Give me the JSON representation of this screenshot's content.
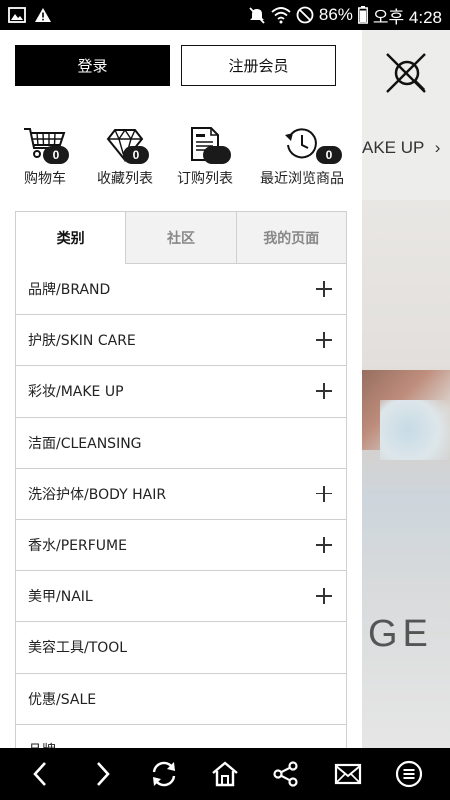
{
  "status_bar": {
    "battery": "86%",
    "time": "오후 4:28"
  },
  "background_page": {
    "banner_text": "AKE UP",
    "banner_chevron": "›",
    "hero_text": "GE"
  },
  "drawer": {
    "login_label": "登录",
    "register_label": "注册会员",
    "quick_links": [
      {
        "label": "购物车",
        "count": "0",
        "icon": "cart-icon"
      },
      {
        "label": "收藏列表",
        "count": "0",
        "icon": "diamond-icon"
      },
      {
        "label": "订购列表",
        "count": "",
        "icon": "document-icon"
      },
      {
        "label": "最近浏览商品",
        "count": "0",
        "icon": "history-clock-icon"
      }
    ],
    "tabs": [
      "类别",
      "社区",
      "我的页面"
    ],
    "categories": [
      {
        "label": "品牌/BRAND",
        "expandable": true
      },
      {
        "label": "护肤/SKIN CARE",
        "expandable": true
      },
      {
        "label": "彩妆/MAKE UP",
        "expandable": true
      },
      {
        "label": "洁面/CLEANSING",
        "expandable": false
      },
      {
        "label": "洗浴护体/BODY HAIR",
        "expandable": true
      },
      {
        "label": "香水/PERFUME",
        "expandable": true
      },
      {
        "label": "美甲/NAIL",
        "expandable": true
      },
      {
        "label": "美容工具/TOOL",
        "expandable": false
      },
      {
        "label": "优惠/SALE",
        "expandable": false
      },
      {
        "label": "品牌",
        "expandable": false
      }
    ]
  },
  "bottom_nav": [
    "back-icon",
    "forward-icon",
    "refresh-icon",
    "home-icon",
    "share-icon",
    "mail-icon",
    "menu-icon"
  ],
  "colors": {
    "accent": "#000000",
    "border": "#cfcfcf",
    "tab_inactive_bg": "#f2f2f2"
  }
}
